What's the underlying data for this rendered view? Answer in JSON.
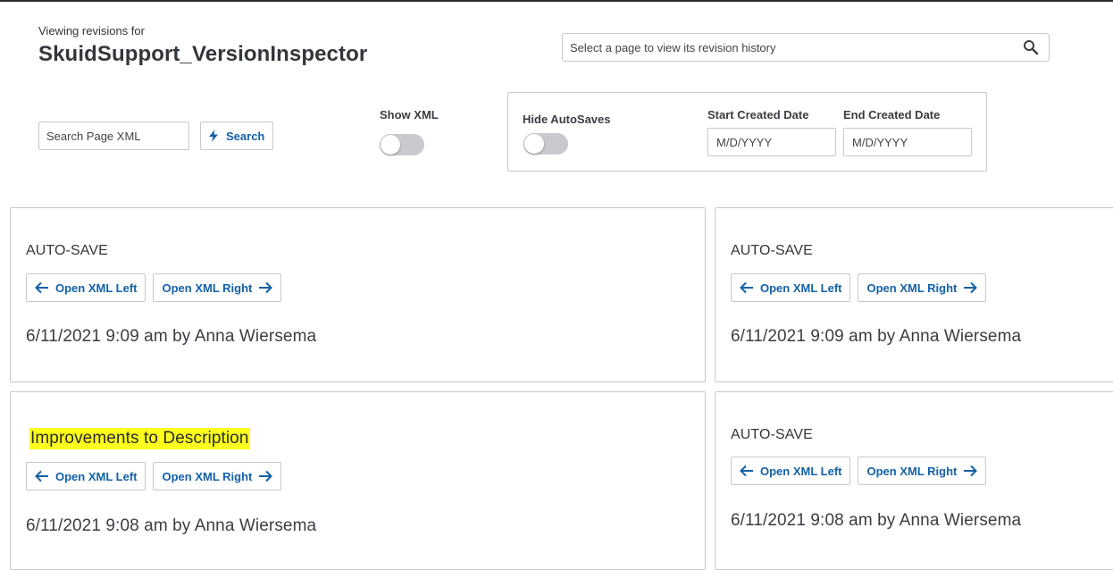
{
  "header": {
    "subtitle": "Viewing revisions for",
    "title": "SkuidSupport_VersionInspector"
  },
  "page_picker": {
    "placeholder": "Select a page to view its revision history",
    "icon": "search-icon"
  },
  "search": {
    "placeholder": "Search Page XML",
    "button_label": "Search",
    "button_icon": "lightning-icon"
  },
  "show_xml": {
    "label": "Show XML",
    "on": false
  },
  "filters": {
    "hide_autosaves_label": "Hide AutoSaves",
    "hide_autosaves_on": false,
    "start_label": "Start Created Date",
    "start_placeholder": "M/D/YYYY",
    "end_label": "End Created Date",
    "end_placeholder": "M/D/YYYY"
  },
  "buttons": {
    "open_left": "Open XML Left",
    "open_right": "Open XML Right"
  },
  "colors": {
    "accent": "#1460a8",
    "highlight": "#ffff1e",
    "border": "#c7c9cc"
  },
  "revisions": [
    {
      "type": "AUTO-SAVE",
      "meta": "6/11/2021 9:09 am by Anna Wiersema"
    },
    {
      "type": "AUTO-SAVE",
      "meta": "6/11/2021 9:09 am by Anna Wiersema"
    },
    {
      "type": "Improvements to Description",
      "meta": "6/11/2021 9:08 am by Anna Wiersema"
    },
    {
      "type": "AUTO-SAVE",
      "meta": "6/11/2021 9:08 am by Anna Wiersema"
    }
  ]
}
